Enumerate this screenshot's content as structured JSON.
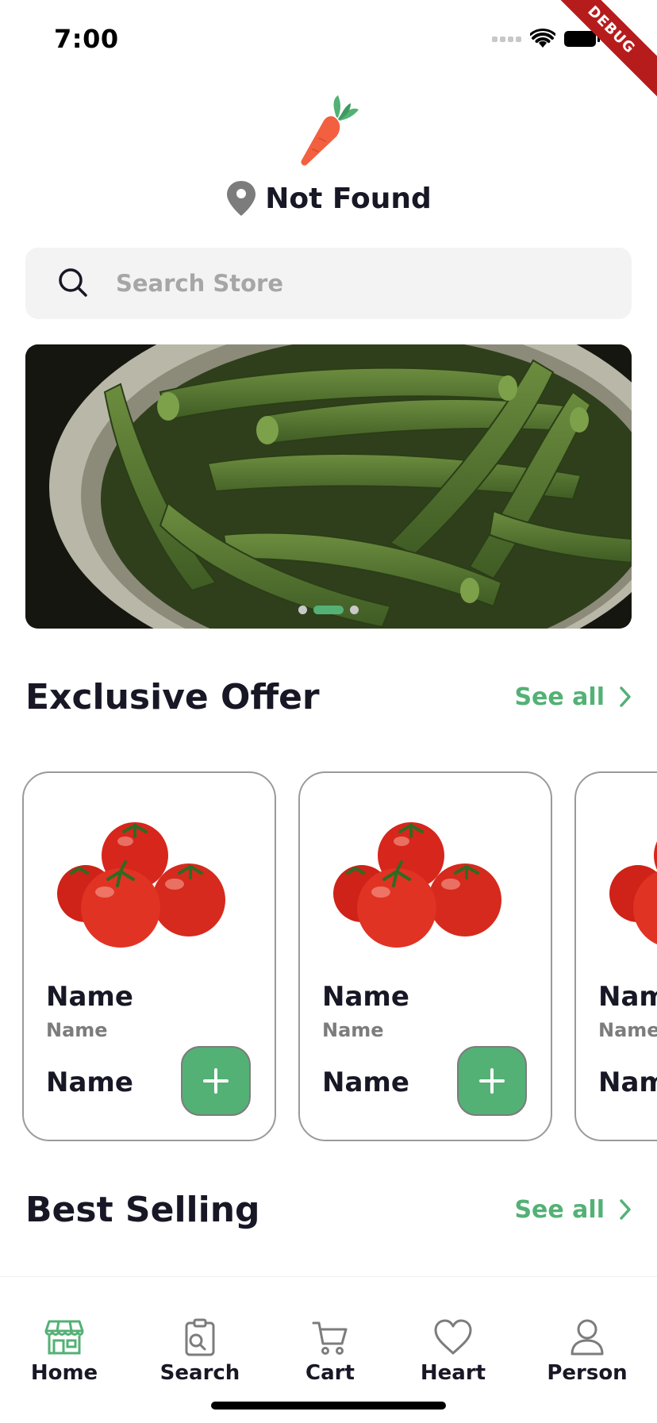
{
  "status_bar": {
    "time": "7:00",
    "debug_label": "DEBUG"
  },
  "header": {
    "location": "Not Found"
  },
  "search": {
    "placeholder": "Search Store"
  },
  "banner": {
    "image": "okra-in-bowl",
    "page_count": 3,
    "active_page": 2
  },
  "sections": {
    "exclusive_offer": {
      "title": "Exclusive Offer",
      "see_all": "See all"
    },
    "best_selling": {
      "title": "Best Selling",
      "see_all": "See all"
    }
  },
  "products": [
    {
      "name": "Name",
      "subtitle": "Name",
      "price": "Name",
      "image": "tomatoes"
    },
    {
      "name": "Name",
      "subtitle": "Name",
      "price": "Name",
      "image": "tomatoes"
    },
    {
      "name": "Name",
      "subtitle": "Name",
      "price": "Name",
      "image": "tomatoes"
    }
  ],
  "bottom_nav": [
    {
      "label": "Home",
      "icon": "store-icon",
      "active": true
    },
    {
      "label": "Search",
      "icon": "search-doc-icon",
      "active": false
    },
    {
      "label": "Cart",
      "icon": "cart-icon",
      "active": false
    },
    {
      "label": "Heart",
      "icon": "heart-icon",
      "active": false
    },
    {
      "label": "Person",
      "icon": "person-icon",
      "active": false
    }
  ],
  "colors": {
    "accent": "#53b175",
    "text": "#181725",
    "muted": "#7c7c7c",
    "search_bg": "#f2f3f2",
    "carrot": "#f3603f"
  }
}
